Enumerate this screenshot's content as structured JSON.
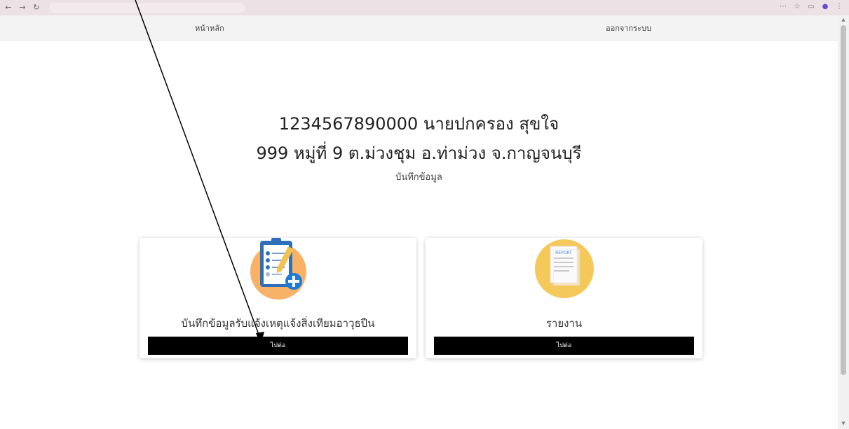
{
  "navbar": {
    "home_label": "หน้าหลัก",
    "logout_label": "ออกจากระบบ"
  },
  "header": {
    "line1": "1234567890000 นายปกครอง สุขใจ",
    "line2": "999 หมู่ที่ 9  ต.ม่วงชุม อ.ท่าม่วง จ.กาญจนบุรี",
    "subtitle": "บันทึกข้อมูล"
  },
  "cards": [
    {
      "title": "บันทึกข้อมูลรับแจ้งเหตุแจ้งสิ่งเทียมอาวุธปืน",
      "button": "ไปต่อ",
      "icon": "clipboard-checklist-icon"
    },
    {
      "title": "รายงาน",
      "button": "ไปต่อ",
      "icon": "report-document-icon",
      "icon_text": "REPORT"
    }
  ],
  "colors": {
    "accent": "#f7b267",
    "report_circle": "#f5c85a",
    "clipboard": "#2f6fba",
    "plus": "#1f7bd6",
    "button": "#000000"
  }
}
